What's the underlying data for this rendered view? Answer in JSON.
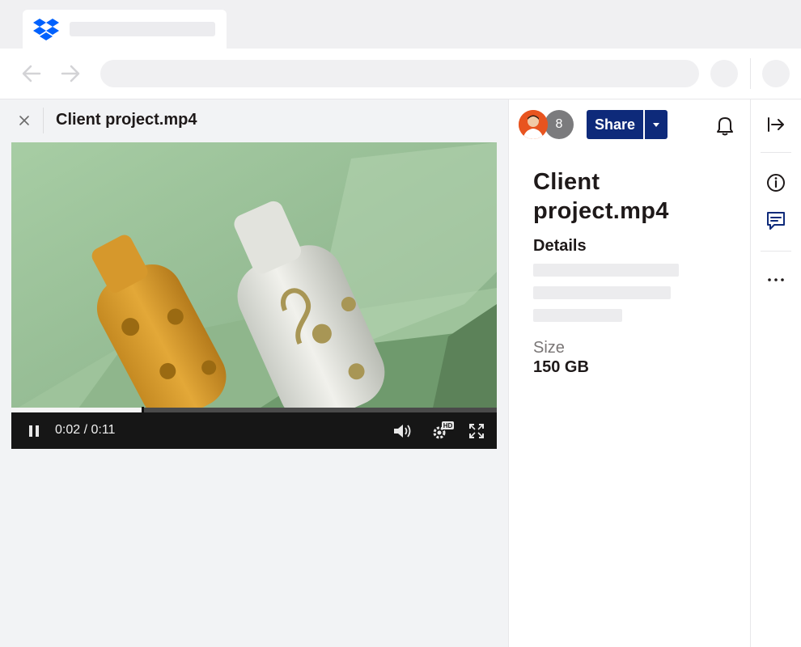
{
  "browser": {
    "tab_logo": "dropbox-logo-icon",
    "nav_icons": [
      "back-arrow-icon",
      "forward-arrow-icon"
    ]
  },
  "preview": {
    "close_icon": "close-icon",
    "file_name": "Client project.mp4",
    "player": {
      "current_time": "0:02",
      "duration": "0:11",
      "time_display": "0:02 / 0:11",
      "progress_fraction": 0.27,
      "quality_badge": "HD",
      "state": "playing"
    }
  },
  "details": {
    "member_count": "8",
    "share_label": "Share",
    "title": "Client project.mp4",
    "details_heading": "Details",
    "size_label": "Size",
    "size_value": "150 GB"
  },
  "rail": {
    "icons": [
      "collapse-panel-icon",
      "info-icon",
      "comment-icon",
      "more-icon"
    ]
  },
  "colors": {
    "brand_blue": "#0061fe",
    "share_button": "#0e2a7a",
    "avatar_bg": "#e8541f",
    "badge_bg": "#7b7b7d"
  }
}
